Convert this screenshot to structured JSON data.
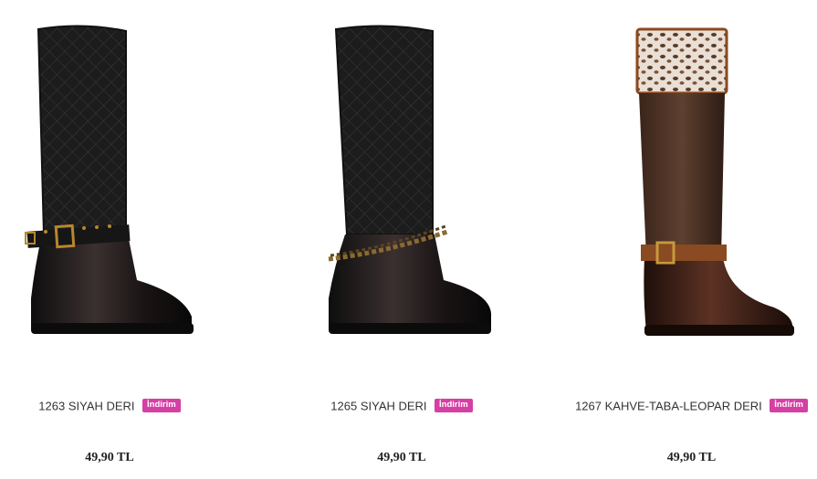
{
  "products": [
    {
      "name": "1263 SIYAH DERI",
      "badge": "İndirim",
      "price": "49,90 TL"
    },
    {
      "name": "1265 SIYAH DERI",
      "badge": "İndirim",
      "price": "49,90 TL"
    },
    {
      "name": "1267 KAHVE-TABA-LEOPAR DERI",
      "badge": "İndirim",
      "price": "49,90 TL"
    }
  ],
  "colors": {
    "badge": "#d63fa4",
    "boot_black": "#1a1a1a",
    "boot_brown": "#4a2c1f",
    "strap_tan": "#8a4a22"
  },
  "icons": [
    "boot-image-black-buckle",
    "boot-image-black-chain",
    "boot-image-brown-leopard"
  ]
}
